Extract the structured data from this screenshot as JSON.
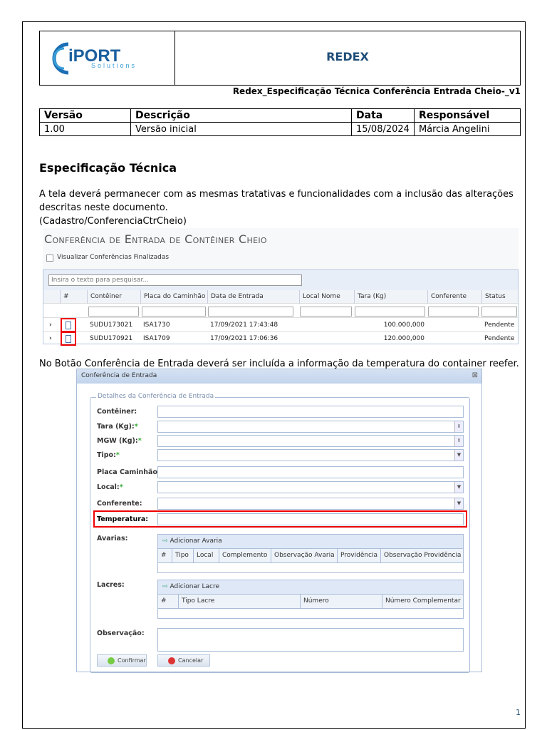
{
  "header": {
    "logo_text": "iPORT",
    "logo_sub": "Solutions",
    "title": "REDEX",
    "doc_name": "Redex_Especificação Técnica Conferência Entrada Cheio-_v1"
  },
  "version_table": {
    "headers": [
      "Versão",
      "Descrição",
      "Data",
      "Responsável"
    ],
    "rows": [
      [
        "1.00",
        "Versão inicial",
        "15/08/2024",
        "Márcia Angelini"
      ]
    ]
  },
  "section_title": "Especificação Técnica",
  "paragraph1": "A tela deverá permanecer com as mesmas tratativas e funcionalidades com a inclusão das alterações descritas neste documento.",
  "paragraph2": "(Cadastro/ConferenciaCtrCheio)",
  "screen1": {
    "title": "Conferência de Entrada de Contêiner Cheio",
    "checkbox_label": "Visualizar Conferências Finalizadas",
    "search_placeholder": "Insira o texto para pesquisar...",
    "columns": [
      "#",
      "Contêiner",
      "Placa do Caminhão",
      "Data de Entrada",
      "Local Nome",
      "Tara (Kg)",
      "Conferente",
      "Status"
    ],
    "rows": [
      {
        "container": "SUDU173021",
        "placa": "ISA1730",
        "data": "17/09/2021 17:43:48",
        "local": "",
        "tara": "100.000,000",
        "conferente": "",
        "status": "Pendente"
      },
      {
        "container": "SUDU170921",
        "placa": "ISA1709",
        "data": "17/09/2021 17:06:36",
        "local": "",
        "tara": "120.000,000",
        "conferente": "",
        "status": "Pendente"
      }
    ]
  },
  "paragraph3": "No Botão Conferência de Entrada deverá ser incluída a informação da temperatura do container reefer.",
  "dialog": {
    "title": "Conferência de Entrada",
    "legend": "Detalhes da Conferência de Entrada",
    "fields": {
      "container": "Contêiner:",
      "tara": "Tara (Kg):",
      "mgw": "MGW (Kg):",
      "tipo": "Tipo:",
      "placa": "Placa Caminhão:",
      "local": "Local:",
      "conferente": "Conferente:",
      "temperatura": "Temperatura:",
      "avarias": "Avarias:",
      "lacres": "Lacres:",
      "observacao": "Observação:"
    },
    "required_mark": "*",
    "avarias": {
      "add_label": "Adicionar Avaria",
      "columns": [
        "#",
        "Tipo",
        "Local",
        "Complemento",
        "Observação Avaria",
        "Providência",
        "Observação Providência"
      ]
    },
    "lacres": {
      "add_label": "Adicionar Lacre",
      "columns": [
        "#",
        "Tipo Lacre",
        "Número",
        "Número Complementar"
      ]
    },
    "confirm_label": "Confirmar",
    "cancel_label": "Cancelar"
  },
  "page_number": "1"
}
